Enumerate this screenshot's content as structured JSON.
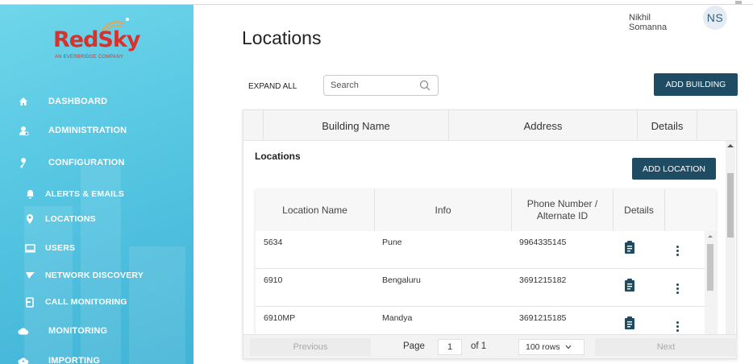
{
  "brand": {
    "name": "RedSky",
    "tagline": "AN EVERBRIDGE COMPANY"
  },
  "sidebar": {
    "items": [
      {
        "label": "DASHBOARD",
        "icon": "home-icon"
      },
      {
        "label": "ADMINISTRATION",
        "icon": "admin-icon"
      },
      {
        "label": "CONFIGURATION",
        "icon": "wrench-icon"
      },
      {
        "label": "ALERTS & EMAILS",
        "icon": "bell-icon"
      },
      {
        "label": "LOCATIONS",
        "icon": "location-pin-icon"
      },
      {
        "label": "USERS",
        "icon": "monitor-icon"
      },
      {
        "label": "NETWORK DISCOVERY",
        "icon": "funnel-icon"
      },
      {
        "label": "CALL MONITORING",
        "icon": "phone-icon"
      },
      {
        "label": "MONITORING",
        "icon": "cloud-icon"
      },
      {
        "label": "IMPORTING",
        "icon": "upload-cloud-icon"
      }
    ]
  },
  "header": {
    "user_name": "Nikhil Somanna",
    "user_initials": "NS"
  },
  "page": {
    "title": "Locations"
  },
  "toolbar": {
    "expand_all": "EXPAND ALL",
    "search_placeholder": "Search",
    "add_building": "ADD BUILDING"
  },
  "buildings_table": {
    "columns": [
      "Building Name",
      "Address",
      "Details"
    ]
  },
  "locations": {
    "title": "Locations",
    "add_location": "ADD LOCATION",
    "columns": [
      "Location Name",
      "Info",
      "Phone Number / Alternate ID",
      "Details"
    ],
    "rows": [
      {
        "name": "5634",
        "info": "Pune",
        "phone": "9964335145"
      },
      {
        "name": "6910",
        "info": "Bengaluru",
        "phone": "3691215182"
      },
      {
        "name": "6910MP",
        "info": "Mandya",
        "phone": "3691215185"
      }
    ]
  },
  "pager": {
    "previous": "Previous",
    "page_label": "Page",
    "page": "1",
    "of": "of 1",
    "rows": "100 rows",
    "next": "Next"
  },
  "colors": {
    "primary": "#204c63",
    "brand_red": "#d9312b",
    "sidebar": "#56c6e2"
  }
}
